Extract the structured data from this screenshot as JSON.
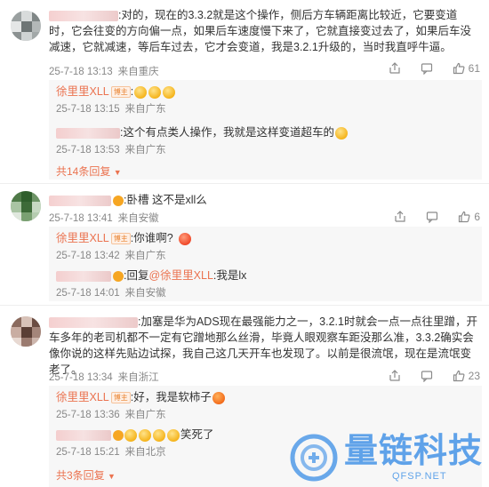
{
  "comments": [
    {
      "text": ":对的，现在的3.3.2就是这个操作，侧后方车辆距离比较近，它要变道时，它会往变的方向偏一点，如果后车速度慢下来了，它就直接变过去了，如果后车没减速，它就减速，等后车过去，它才会变道，我是3.2.1升级的，当时我直呼牛逼。",
      "time": "25-7-18 13:13",
      "location": "来自重庆",
      "like_count": "61",
      "replies": [
        {
          "author": "徐里里XLL",
          "badge": "博主",
          "text": ":",
          "time": "25-7-18 13:15",
          "location": "来自广东"
        },
        {
          "author": "",
          "text": ":这个有点类人操作，我就是这样变道超车的",
          "time": "25-7-18 13:53",
          "location": "来自广东"
        }
      ],
      "more_label": "共14条回复"
    },
    {
      "text": ":卧槽  这不是xll么",
      "time": "25-7-18 13:41",
      "location": "来自安徽",
      "like_count": "6",
      "replies": [
        {
          "author": "徐里里XLL",
          "badge": "博主",
          "text": ":你谁啊?",
          "time": "25-7-18 13:42",
          "location": "来自广东"
        },
        {
          "author": "",
          "text": ":回复",
          "mention": "@徐里里XLL",
          "text2": ":我是lx",
          "time": "25-7-18 14:01",
          "location": "来自安徽"
        }
      ]
    },
    {
      "text": ":加塞是华为ADS现在最强能力之一，3.2.1时就会一点一点往里蹭，开车多年的老司机都不一定有它蹭地那么丝滑，毕竟人眼观察车距没那么准，3.3.2确实会像你说的这样先贴边试探，我自己这几天开车也发现了。以前是很流氓，现在是流氓变老了。",
      "time": "25-7-18 13:34",
      "location": "来自浙江",
      "like_count": "23",
      "replies": [
        {
          "author": "徐里里XLL",
          "badge": "博主",
          "text": ":好，我是软柿子",
          "time": "25-7-18 13:36",
          "location": "来自广东"
        },
        {
          "author": "",
          "text": "笑死了",
          "time": "25-7-18 15:21",
          "location": "来自北京"
        }
      ],
      "more_label": "共3条回复"
    }
  ],
  "watermark": {
    "title": "量链科技",
    "sub": "QFSP.NET"
  },
  "colors": {
    "accent": "#eb7350",
    "meta": "#888888",
    "reply_bg": "#f7f7f7",
    "watermark": "#3a8ee6"
  },
  "icons": [
    "share-icon",
    "comment-icon",
    "like-icon"
  ]
}
